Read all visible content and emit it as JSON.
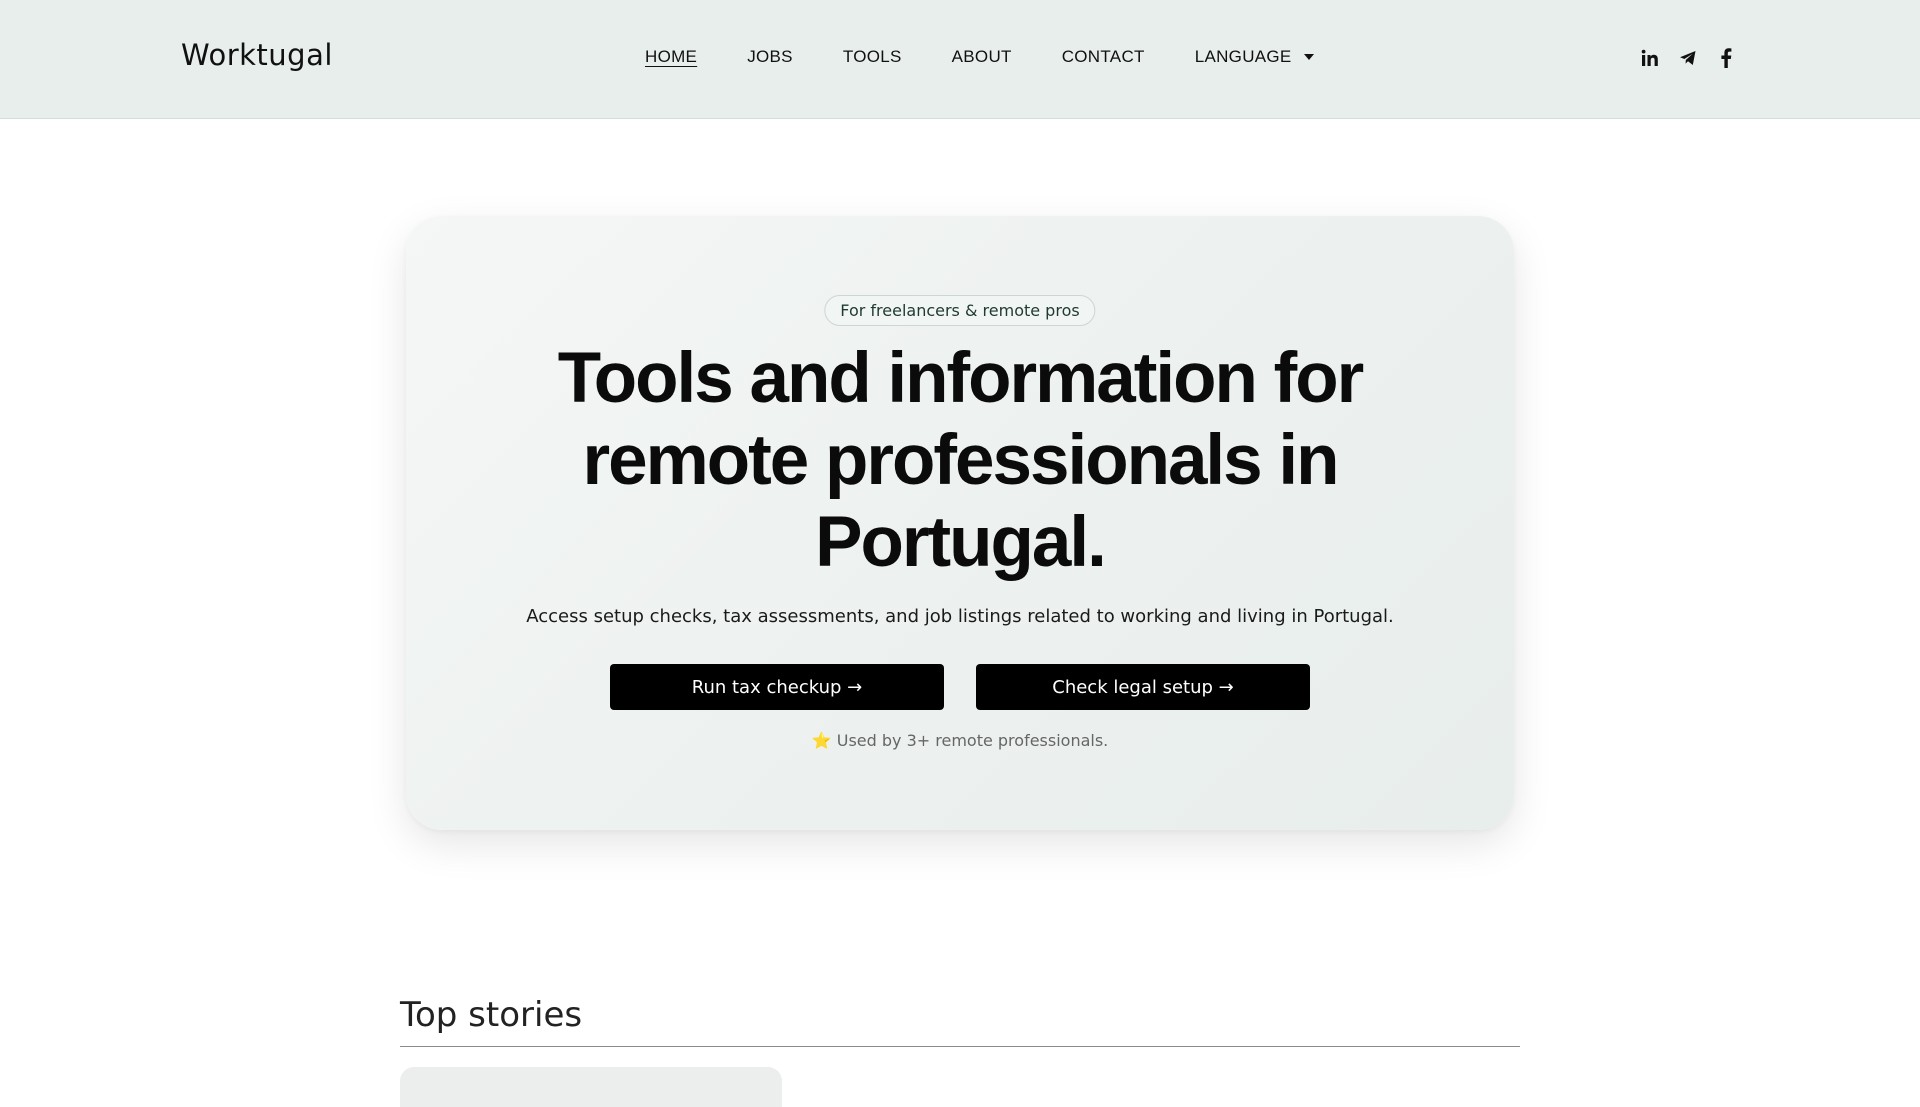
{
  "header": {
    "logo": "Worktugal",
    "nav": [
      {
        "label": "HOME",
        "active": true
      },
      {
        "label": "JOBS",
        "active": false
      },
      {
        "label": "TOOLS",
        "active": false
      },
      {
        "label": "ABOUT",
        "active": false
      },
      {
        "label": "CONTACT",
        "active": false
      }
    ],
    "language_label": "LANGUAGE",
    "social_icons": [
      "linkedin-icon",
      "telegram-icon",
      "facebook-icon"
    ]
  },
  "hero": {
    "pill": "For freelancers & remote pros",
    "title": "Tools and information for remote professionals in Portugal.",
    "subtitle": "Access setup checks, tax assessments, and job listings related to working and living in Portugal.",
    "cta_primary": "Run tax checkup →",
    "cta_secondary": "Check legal setup →",
    "social_proof_icon": "⭐",
    "social_proof": "Used by 3+ remote professionals."
  },
  "stories": {
    "title": "Top stories"
  },
  "colors": {
    "header_bg": "#e8eeec",
    "button_bg": "#000000",
    "button_text": "#ffffff"
  }
}
